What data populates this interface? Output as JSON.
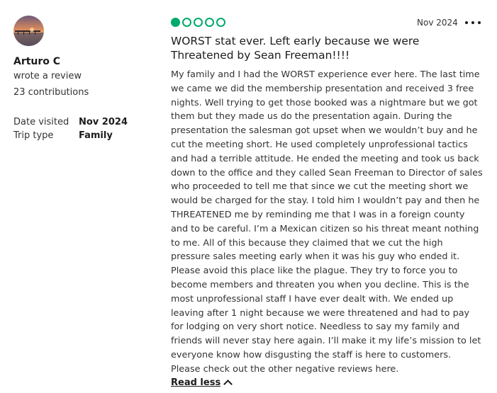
{
  "reviewer": {
    "name": "Arturo C",
    "action": "wrote a review",
    "contributions": "23 contributions",
    "avatar_icon": "sunset-pier-photo"
  },
  "trip": {
    "date_visited_label": "Date visited",
    "date_visited_value": "Nov 2024",
    "trip_type_label": "Trip type",
    "trip_type_value": "Family"
  },
  "review": {
    "rating": 1,
    "rating_max": 5,
    "rating_color": "#00aa6c",
    "date": "Nov 2024",
    "title": "WORST stat ever. Left early because we were Threatened by Sean Freeman!!!!",
    "body": "My family and I had the WORST experience ever here. The last time we came we did the membership presentation and received 3 free nights. Well trying to get those booked was a nightmare but we got them but they made us do the presentation again. During the presentation the salesman got upset when we wouldn’t buy and he cut the meeting short. He used completely unprofessional tactics and had a terrible attitude. He ended the meeting and took us back down to the office and they called Sean Freeman to Director of sales who proceeded to tell me that since we cut the meeting short we would be charged for the stay. I told him I wouldn’t pay and then he THREATENED me by reminding me that I was in a foreign county and to be careful. I’m a Mexican citizen so his threat meant nothing to me. All of this because they claimed that we cut the high pressure sales meeting early when it was his guy who ended it. Please avoid this place like the plague. They try to force you to become members and threaten you when you decline. This is the most unprofessional staff I have ever dealt with. We ended up leaving after 1 night because we were threatened and had to pay for lodging on very short notice. Needless to say my family and friends will never stay here again. I’ll make it my life’s mission to let everyone know how disgusting the staff is here to customers. Please check out the other negative reviews here.",
    "read_less_label": "Read less"
  }
}
